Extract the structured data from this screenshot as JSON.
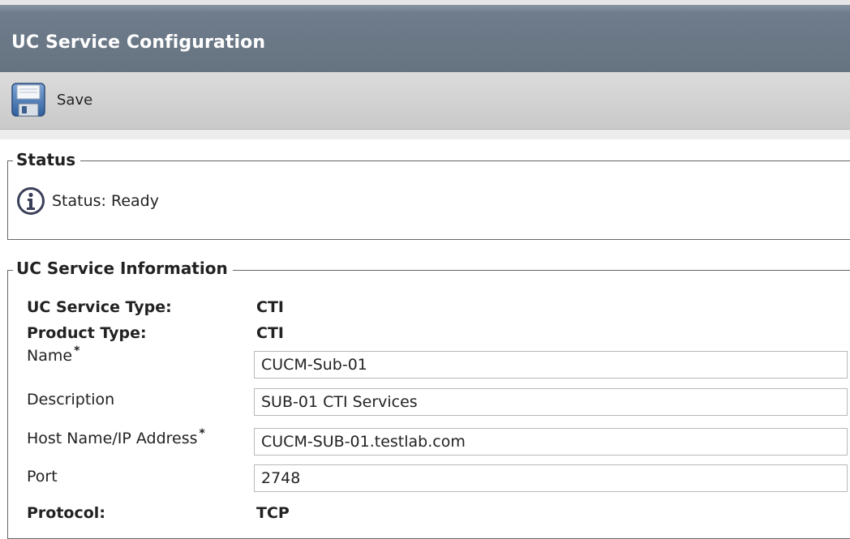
{
  "header": {
    "title": "UC Service Configuration"
  },
  "toolbar": {
    "save_label": "Save",
    "save_icon": "floppy-disk-icon"
  },
  "status": {
    "legend": "Status",
    "icon": "info-icon",
    "text": "Status: Ready"
  },
  "info": {
    "legend": "UC Service Information",
    "service_type_label": "UC Service Type:",
    "service_type_value": "CTI",
    "product_type_label": "Product Type:",
    "product_type_value": "CTI",
    "name_label": "Name",
    "name_value": "CUCM-Sub-01",
    "description_label": "Description",
    "description_value": "SUB-01 CTI Services",
    "host_label": "Host Name/IP Address",
    "host_value": "CUCM-SUB-01.testlab.com",
    "port_label": "Port",
    "port_value": "2748",
    "protocol_label": "Protocol:",
    "protocol_value": "TCP",
    "required_mark": "*"
  },
  "colors": {
    "titlebar": "#6f7c8c",
    "toolbar": "#d3d3d3"
  }
}
